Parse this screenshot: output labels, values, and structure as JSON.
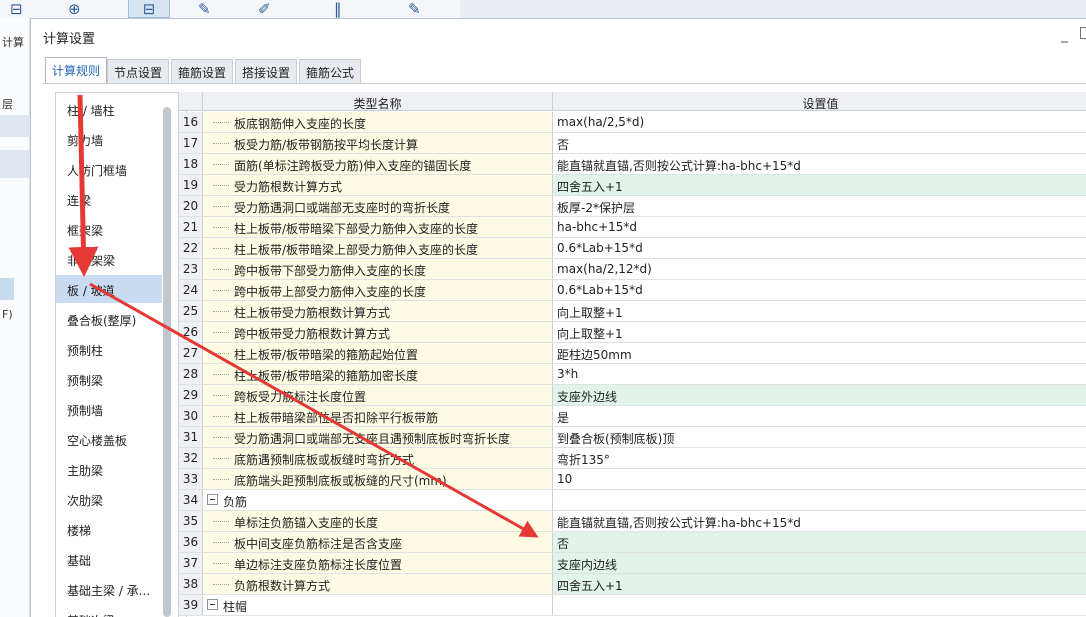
{
  "background_app": {
    "side_label": "计算",
    "left_labels": [
      "层",
      "F)"
    ]
  },
  "dialog": {
    "title": "计算设置",
    "minimize": "_"
  },
  "tabs": [
    {
      "label": "计算规则",
      "active": true
    },
    {
      "label": "节点设置",
      "active": false
    },
    {
      "label": "箍筋设置",
      "active": false
    },
    {
      "label": "搭接设置",
      "active": false
    },
    {
      "label": "箍筋公式",
      "active": false
    }
  ],
  "categories": [
    {
      "label": "柱 / 墙柱"
    },
    {
      "label": "剪力墙"
    },
    {
      "label": "人防门框墙"
    },
    {
      "label": "连梁"
    },
    {
      "label": "框架梁"
    },
    {
      "label": "非框架梁"
    },
    {
      "label": "板 / 坡道",
      "selected": true
    },
    {
      "label": "叠合板(整厚)"
    },
    {
      "label": "预制柱"
    },
    {
      "label": "预制梁"
    },
    {
      "label": "预制墙"
    },
    {
      "label": "空心楼盖板"
    },
    {
      "label": "主肋梁"
    },
    {
      "label": "次肋梁"
    },
    {
      "label": "楼梯"
    },
    {
      "label": "基础"
    },
    {
      "label": "基础主梁 / 承..."
    },
    {
      "label": "基础次梁"
    }
  ],
  "grid": {
    "headers": {
      "name": "类型名称",
      "value": "设置值"
    },
    "rows": [
      {
        "num": "16",
        "name": "板底钢筋伸入支座的长度",
        "value": "max(ha/2,5*d)"
      },
      {
        "num": "17",
        "name": "板受力筋/板带钢筋按平均长度计算",
        "value": "否"
      },
      {
        "num": "18",
        "name": "面筋(单标注跨板受力筋)伸入支座的锚固长度",
        "value": "能直锚就直锚,否则按公式计算:ha-bhc+15*d"
      },
      {
        "num": "19",
        "name": "受力筋根数计算方式",
        "value": "四舍五入+1",
        "highlight": true
      },
      {
        "num": "20",
        "name": "受力筋遇洞口或端部无支座时的弯折长度",
        "value": "板厚-2*保护层"
      },
      {
        "num": "21",
        "name": "柱上板带/板带暗梁下部受力筋伸入支座的长度",
        "value": "ha-bhc+15*d"
      },
      {
        "num": "22",
        "name": "柱上板带/板带暗梁上部受力筋伸入支座的长度",
        "value": "0.6*Lab+15*d"
      },
      {
        "num": "23",
        "name": "跨中板带下部受力筋伸入支座的长度",
        "value": "max(ha/2,12*d)"
      },
      {
        "num": "24",
        "name": "跨中板带上部受力筋伸入支座的长度",
        "value": "0.6*Lab+15*d"
      },
      {
        "num": "25",
        "name": "柱上板带受力筋根数计算方式",
        "value": "向上取整+1"
      },
      {
        "num": "26",
        "name": "跨中板带受力筋根数计算方式",
        "value": "向上取整+1"
      },
      {
        "num": "27",
        "name": "柱上板带/板带暗梁的箍筋起始位置",
        "value": "距柱边50mm"
      },
      {
        "num": "28",
        "name": "柱上板带/板带暗梁的箍筋加密长度",
        "value": "3*h"
      },
      {
        "num": "29",
        "name": "跨板受力筋标注长度位置",
        "value": "支座外边线",
        "highlight": true
      },
      {
        "num": "30",
        "name": "柱上板带暗梁部位是否扣除平行板带筋",
        "value": "是"
      },
      {
        "num": "31",
        "name": "受力筋遇洞口或端部无支座且遇预制底板时弯折长度",
        "value": "到叠合板(预制底板)顶"
      },
      {
        "num": "32",
        "name": "底筋遇预制底板或板缝时弯折方式",
        "value": "弯折135°"
      },
      {
        "num": "33",
        "name": "底筋端头距预制底板或板缝的尺寸(mm)",
        "value": "10"
      },
      {
        "num": "34",
        "name": "负筋",
        "value": "",
        "group": true
      },
      {
        "num": "35",
        "name": "单标注负筋锚入支座的长度",
        "value": "能直锚就直锚,否则按公式计算:ha-bhc+15*d"
      },
      {
        "num": "36",
        "name": "板中间支座负筋标注是否含支座",
        "value": "否",
        "highlight": true
      },
      {
        "num": "37",
        "name": "单边标注支座负筋标注长度位置",
        "value": "支座内边线",
        "highlight": true
      },
      {
        "num": "38",
        "name": "负筋根数计算方式",
        "value": "四舍五入+1",
        "highlight": true
      },
      {
        "num": "39",
        "name": "柱帽",
        "value": "",
        "group": true
      }
    ]
  },
  "colors": {
    "accent": "#2566b8",
    "name_cell_bg": "#fdfbe4",
    "value_highlight_bg": "#e2f3ea",
    "selection_bg": "#c8dbf0",
    "arrow": "#e53935"
  }
}
